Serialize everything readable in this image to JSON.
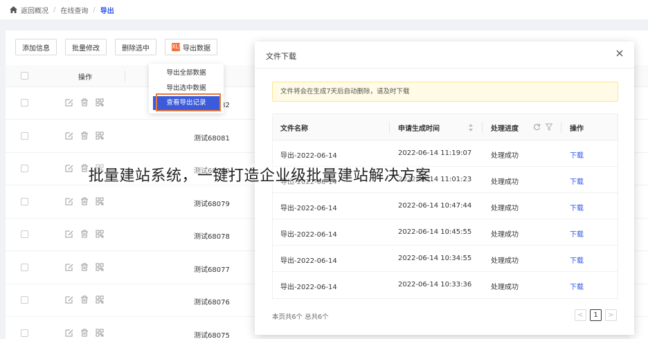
{
  "breadcrumb": {
    "items": [
      "返回概况",
      "在线查询",
      "导出"
    ]
  },
  "toolbar": {
    "buttons": [
      "添加信息",
      "批量修改",
      "删除选中",
      "导出数据"
    ],
    "export_icon_text": "XLS"
  },
  "table": {
    "header_operation": "操作",
    "rows": [
      {
        "name": "测试68082"
      },
      {
        "name": "测试68081"
      },
      {
        "name": "测试68080"
      },
      {
        "name": "测试68079"
      },
      {
        "name": "测试68078"
      },
      {
        "name": "测试68077"
      },
      {
        "name": "测试68076"
      },
      {
        "name": "测试68075"
      }
    ]
  },
  "dropdown": {
    "items": [
      "导出全部数据",
      "导出选中数据",
      "查看导出记录"
    ]
  },
  "modal": {
    "title": "文件下载",
    "notice": "文件将会在生成7天后自动删除，请及时下载",
    "columns": [
      "文件名称",
      "申请生成时间",
      "处理进度",
      "操作"
    ],
    "rows": [
      {
        "file": "导出-2022-06-14",
        "time": "2022-06-14 11:19:07",
        "status": "处理成功",
        "action": "下载"
      },
      {
        "file": "导出-2022-06-14",
        "time": "2022-06-14 11:01:23",
        "status": "处理成功",
        "action": "下载"
      },
      {
        "file": "导出-2022-06-14",
        "time": "2022-06-14 10:47:44",
        "status": "处理成功",
        "action": "下载"
      },
      {
        "file": "导出-2022-06-14",
        "time": "2022-06-14 10:45:55",
        "status": "处理成功",
        "action": "下载"
      },
      {
        "file": "导出-2022-06-14",
        "time": "2022-06-14 10:34:55",
        "status": "处理成功",
        "action": "下载"
      },
      {
        "file": "导出-2022-06-14",
        "time": "2022-06-14 10:33:36",
        "status": "处理成功",
        "action": "下载"
      }
    ],
    "pager_info": "本页共6个 总共6个",
    "pager_prev": "<",
    "pager_current": "1",
    "pager_next": ">"
  },
  "overlay_caption": "批量建站系统，一键打造企业级批量建站解决方案",
  "colors": {
    "accent": "#2f54eb",
    "dropdown_active": "#3b5bdb",
    "highlight_border": "#e8793a",
    "notice_bg": "#fffbe6"
  }
}
